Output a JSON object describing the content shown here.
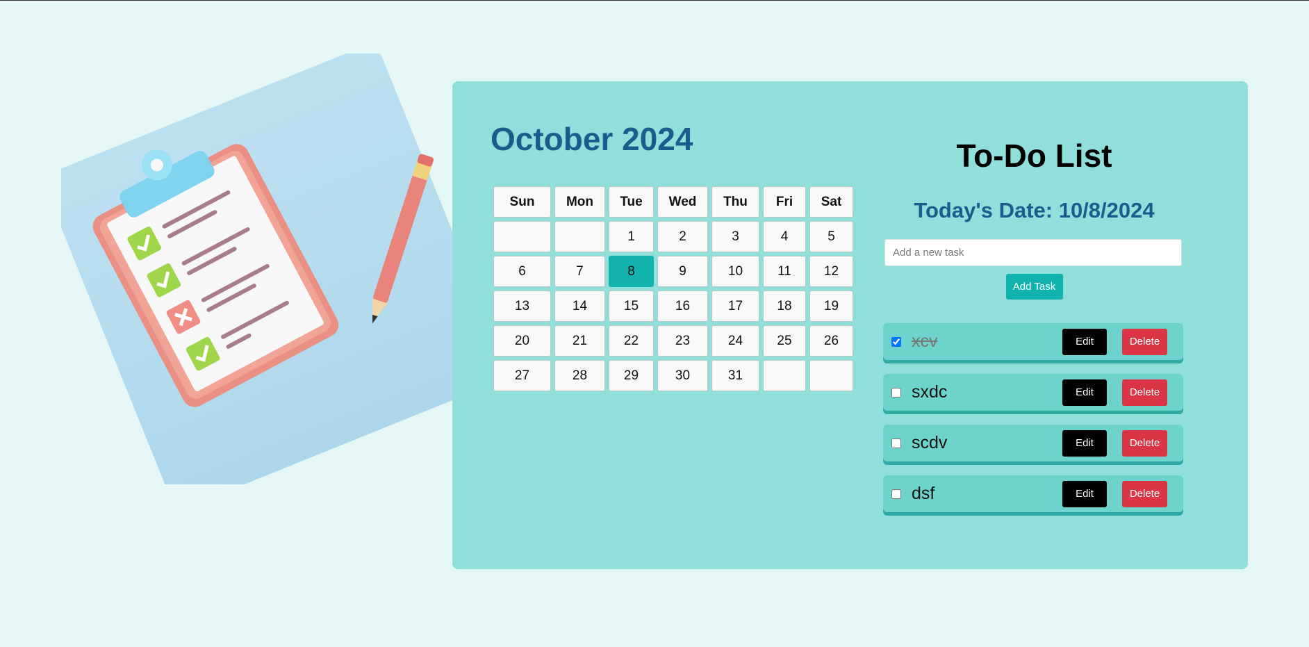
{
  "calendar": {
    "title": "October 2024",
    "weekdays": [
      "Sun",
      "Mon",
      "Tue",
      "Wed",
      "Thu",
      "Fri",
      "Sat"
    ],
    "weeks": [
      [
        "",
        "",
        "1",
        "2",
        "3",
        "4",
        "5"
      ],
      [
        "6",
        "7",
        "8",
        "9",
        "10",
        "11",
        "12"
      ],
      [
        "13",
        "14",
        "15",
        "16",
        "17",
        "18",
        "19"
      ],
      [
        "20",
        "21",
        "22",
        "23",
        "24",
        "25",
        "26"
      ],
      [
        "27",
        "28",
        "29",
        "30",
        "31",
        "",
        ""
      ]
    ],
    "today": "8"
  },
  "todo": {
    "title": "To-Do List",
    "date_label": "Today's Date: 10/8/2024",
    "input_placeholder": "Add a new task",
    "add_label": "Add Task",
    "tasks": [
      {
        "text": "xcv",
        "done": true,
        "edit_label": "Edit",
        "delete_label": "Delete"
      },
      {
        "text": "sxdc",
        "done": false,
        "edit_label": "Edit",
        "delete_label": "Delete"
      },
      {
        "text": "scdv",
        "done": false,
        "edit_label": "Edit",
        "delete_label": "Delete"
      },
      {
        "text": "dsf",
        "done": false,
        "edit_label": "Edit",
        "delete_label": "Delete"
      }
    ]
  },
  "colors": {
    "page_bg": "#e4f6f6",
    "panel_bg": "#90dfda",
    "accent": "#12b3ad",
    "title_blue": "#1e5b8d",
    "delete_red": "#dc3545"
  },
  "illustration": {
    "icons": [
      "clipboard-icon",
      "check-icon",
      "cross-icon",
      "pencil-icon"
    ]
  }
}
